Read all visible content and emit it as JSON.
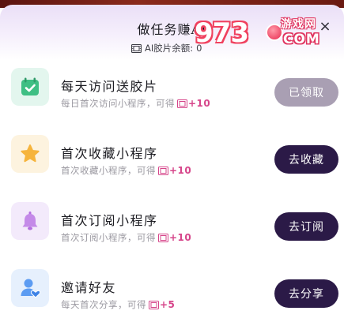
{
  "header": {
    "title": "做任务赚AI",
    "balance_label": "AI胶片余额:",
    "balance_value": "0",
    "close_icon": "close-icon"
  },
  "watermark": {
    "digits": "973",
    "site_cn": "游戏网",
    "site_en": "COM"
  },
  "colors": {
    "accent_dark": "#2b1a47",
    "button_done": "#a99fb3",
    "reward_pink": "#d6458a"
  },
  "tasks": [
    {
      "name": "每天访问送胶片",
      "desc": "每日首次访问小程序，可得",
      "reward": "+10",
      "button": "已领取",
      "status": "done",
      "icon": "calendar-check-icon"
    },
    {
      "name": "首次收藏小程序",
      "desc": "首次收藏小程序，可得",
      "reward": "+10",
      "button": "去收藏",
      "status": "todo",
      "icon": "star-icon"
    },
    {
      "name": "首次订阅小程序",
      "desc": "首次订阅小程序，可得",
      "reward": "+10",
      "button": "去订阅",
      "status": "todo",
      "icon": "bell-icon"
    },
    {
      "name": "邀请好友",
      "desc": "每天首次分享，可得",
      "reward": "+5",
      "button": "去分享",
      "status": "todo",
      "icon": "user-heart-icon"
    }
  ]
}
